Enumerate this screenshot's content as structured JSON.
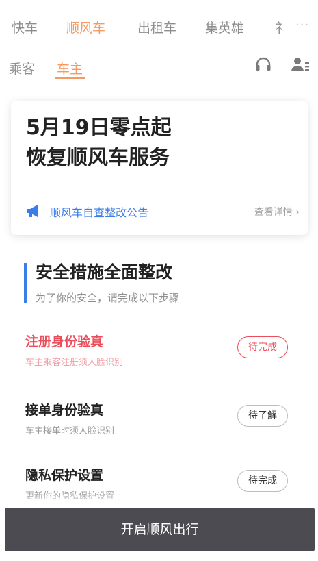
{
  "top_tabs": [
    "快车",
    "顺风车",
    "出租车",
    "集英雄",
    "礻"
  ],
  "more_icon": "more-dots-icon",
  "sub_tabs": [
    "乘客",
    "车主"
  ],
  "sub_icons": [
    "headset-icon",
    "driver-profile-icon"
  ],
  "accent_color": "#f59a62",
  "announcement": {
    "title_line1": "5月19日零点起",
    "title_line2": "恢复顺风车服务",
    "notice": "顺风车自查整改公告",
    "details": "查看详情 ›"
  },
  "section": {
    "title": "安全措施全面整改",
    "subtitle": "为了你的安全，请完成以下步骤"
  },
  "steps": [
    {
      "title": "注册身份验真",
      "desc": "车主乘客注册须人脸识别",
      "status": "待完成",
      "alert": true
    },
    {
      "title": "接单身份验真",
      "desc": "车主接单时须人脸识别",
      "status": "待了解",
      "alert": false
    },
    {
      "title": "隐私保护设置",
      "desc": "更新你的隐私保护设置",
      "status": "待完成",
      "alert": false
    }
  ],
  "primary_button": "开启顺风出行"
}
